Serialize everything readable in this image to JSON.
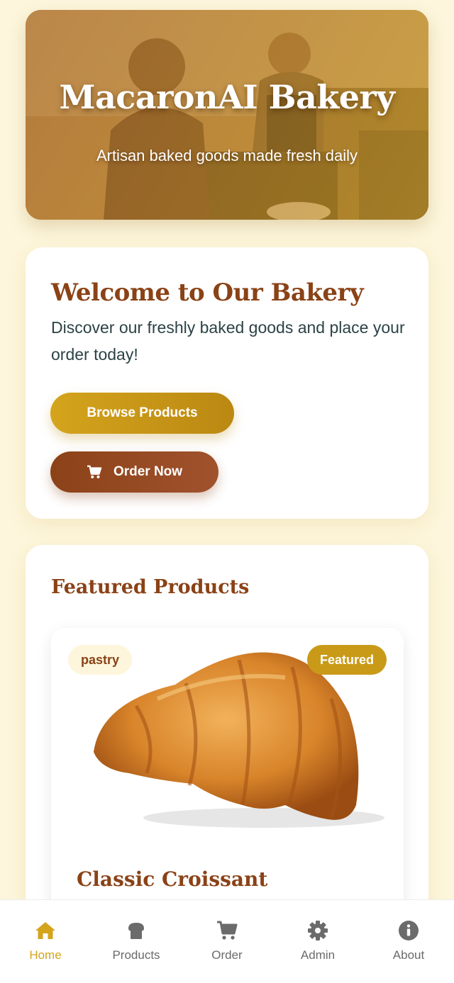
{
  "hero": {
    "title": "MacaronAI Bakery",
    "subtitle": "Artisan baked goods made fresh daily"
  },
  "welcome": {
    "title": "Welcome to Our Bakery",
    "text": "Discover our freshly baked goods and place your order today!",
    "browse_label": "Browse Products",
    "order_label": "Order Now",
    "order_icon": "cart-icon"
  },
  "featured": {
    "title": "Featured Products",
    "product": {
      "category": "pastry",
      "badge": "Featured",
      "name": "Classic Croissant"
    }
  },
  "nav": {
    "items": [
      {
        "label": "Home",
        "icon": "home-icon",
        "active": true
      },
      {
        "label": "Products",
        "icon": "bread-icon",
        "active": false
      },
      {
        "label": "Order",
        "icon": "cart-icon",
        "active": false
      },
      {
        "label": "Admin",
        "icon": "gear-icon",
        "active": false
      },
      {
        "label": "About",
        "icon": "info-icon",
        "active": false
      }
    ]
  },
  "colors": {
    "accent": "#d4a41c",
    "brand_brown": "#8a4216",
    "background": "#fdf6dc",
    "inactive": "#6b6b6b"
  }
}
